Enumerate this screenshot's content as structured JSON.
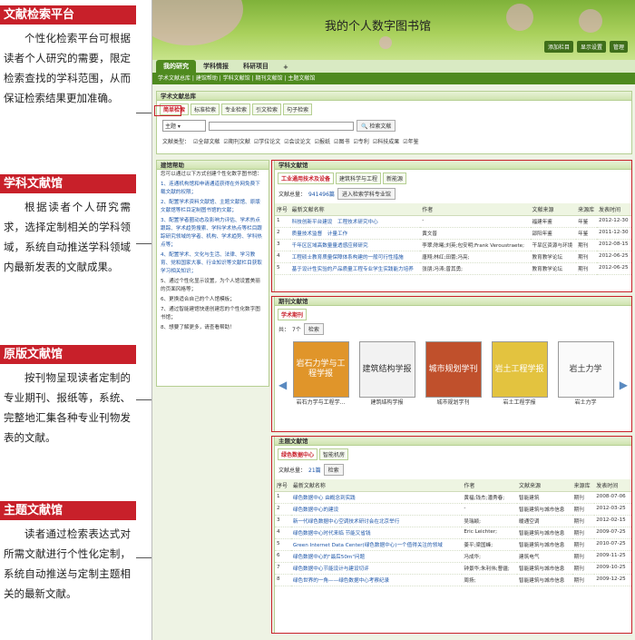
{
  "annotations": [
    {
      "tag": "文献检索平台",
      "desc": "个性化检索平台可根据读者个人研究的需要，限定检索查找的学科范围，从而保证检索结果更加准确。"
    },
    {
      "tag": "学科文献馆",
      "desc": "根据读者个人研究需求，选择定制相关的学科领域，系统自动推送学科领域内最新发表的文献成果。"
    },
    {
      "tag": "原版文献馆",
      "desc": "按刊物呈现读者定制的专业期刊、报纸等，系统、完整地汇集各种专业刊物发表的文献。"
    },
    {
      "tag": "主题文献馆",
      "desc": "读者通过检索表达式对所需文献进行个性化定制，系统自动推送与定制主题相关的最新文献。"
    }
  ],
  "header": {
    "title": "我的个人数字图书馆",
    "buttons": [
      "添加栏目",
      "显示设置",
      "管理"
    ]
  },
  "tabs": [
    "我的研究",
    "学科情报",
    "科研项目",
    "+"
  ],
  "subnav": "学术文献总库 | 建馆帮助 | 学科文献馆 | 期刊文献馆 | 主题文献馆",
  "search": {
    "title": "学术文献总库",
    "tabs": [
      "简单检索",
      "标准检索",
      "专业检索",
      "引文检索",
      "句子检索"
    ],
    "field": "主题",
    "button": "检索文献",
    "type_label": "文献类型：",
    "types": [
      "全部文献",
      "期刊文献",
      "学位论文",
      "会议论文",
      "报纸",
      "图书",
      "专利",
      "科技成果",
      "年鉴"
    ]
  },
  "guide": {
    "title": "建馆帮助",
    "intro": "您可以通过以下方式创建个性化数字图书馆：",
    "steps": [
      "1、连通机构馆和申请通道获得在外网免费下载文献的权限；",
      "2、配置学术资料文献馆、主题文献馆、原版文献馆等栏目定制图书馆的文献；",
      "3、配置学者圈动态及影响力评估、学术热点跟踪、学术趋势搜索、学科学术热点等栏目跟踪研究领域的学者、机构、学术趋势、学科热点等；",
      "4、配置学术、文化与生活、法律、学习教育、党和国家大事、行业知识等文献栏目获取学习相关知识；",
      "5、通过个性化显示设置，为个人馆设置美丽的页面风格等；",
      "6、更换适合自己的个人馆模板；",
      "7、通过智能建馆快速创建您的个性化数字图书馆；",
      "8、想要了解更多，请查看帮助！"
    ]
  },
  "subject": {
    "title": "学科文献馆",
    "tabs": [
      "工业通用技术及设备",
      "建筑科学与工程",
      "新能源"
    ],
    "total_label": "文献总量：",
    "total": "941496篇",
    "enter": "进入检索学科专业馆",
    "headers": [
      "序号",
      "最新文献名称",
      "作者",
      "文献来源",
      "来源库",
      "发表时间"
    ],
    "rows": [
      [
        "1",
        "科技创新平台建设　工程技术研究中心",
        "-",
        "福建年鉴",
        "年鉴",
        "2012-12-30"
      ],
      [
        "2",
        "质量技术监督　计量工作",
        "黄文普",
        "邵阳年鉴",
        "年鉴",
        "2011-12-30"
      ],
      [
        "3",
        "千年区区域高数量量透感应频研究",
        "李翠;陈曦;刘英;包安明;Frank Veroustraete;",
        "干旱区资源与环境",
        "期刊",
        "2012-08-15"
      ],
      [
        "4",
        "工程硕士教育质量保障体系构建的一般可行性措施",
        "唐翔;林红;田蕾;冯亮;",
        "教育教学论坛",
        "期刊",
        "2012-06-25"
      ],
      [
        "5",
        "基于设计性实验的产品质量工程专业学生实践能力培养",
        "张朋;冯涛;曾其勇;",
        "教育教学论坛",
        "期刊",
        "2012-06-25"
      ]
    ]
  },
  "journal": {
    "title": "期刊文献馆",
    "tab": "学术期刊",
    "count_label": "共：",
    "count": "7个",
    "search": "检索",
    "books": [
      {
        "cover": "岩石力学与工程学报",
        "name": "岩石力学与工程学...",
        "color": "#e0952a"
      },
      {
        "cover": "建筑结构学报",
        "name": "建筑结构学报",
        "color": "#f2f2f2"
      },
      {
        "cover": "城市规划学刊",
        "name": "城市规划学刊",
        "color": "#c0502c"
      },
      {
        "cover": "岩土工程学报",
        "name": "岩土工程学报",
        "color": "#e3c33f"
      },
      {
        "cover": "岩土力学",
        "name": "岩土力学",
        "color": "#fafafa"
      }
    ]
  },
  "topic": {
    "title": "主题文献馆",
    "tabs": [
      "绿色数据中心",
      "智能机房"
    ],
    "total_label": "文献总量：",
    "total": "21篇",
    "search": "检索",
    "headers": [
      "序号",
      "最新文献名称",
      "作者",
      "文献来源",
      "来源库",
      "发表时间"
    ],
    "rows": [
      [
        "1",
        "绿色数据中心 由概念到实践",
        "黄福;钱杰;潘秀春;",
        "智能建筑",
        "期刊",
        "2008-07-06"
      ],
      [
        "2",
        "绿色数据中心的建设",
        "-",
        "智能建筑与城市信息",
        "期刊",
        "2012-03-25"
      ],
      [
        "3",
        "新一代绿色数据中心空调技术研讨会在北京举行",
        "吴瑞颖;",
        "暖通空调",
        "期刊",
        "2012-02-15"
      ],
      [
        "4",
        "绿色数据中心时代来临 节能又省钱",
        "Eric Leichter;",
        "智能建筑与城市信息",
        "期刊",
        "2009-07-25"
      ],
      [
        "5",
        "Green Internet Data Center(绿色数据中心)一个值得关注的领域",
        "姜平;梁国峰;",
        "智能建筑与城市信息",
        "期刊",
        "2010-07-25"
      ],
      [
        "6",
        "绿色数据中心的\"最后50m\"问题",
        "冯成华;",
        "建筑电气",
        "期刊",
        "2009-11-25"
      ],
      [
        "7",
        "绿色数据中心节能设计与建设切评",
        "钟景华;朱利伟;曹疆;",
        "智能建筑与城市信息",
        "期刊",
        "2009-10-25"
      ],
      [
        "8",
        "绿色世界的一角——绿色数据中心考察纪录",
        "周扬;",
        "智能建筑与城市信息",
        "期刊",
        "2009-12-25"
      ]
    ]
  }
}
